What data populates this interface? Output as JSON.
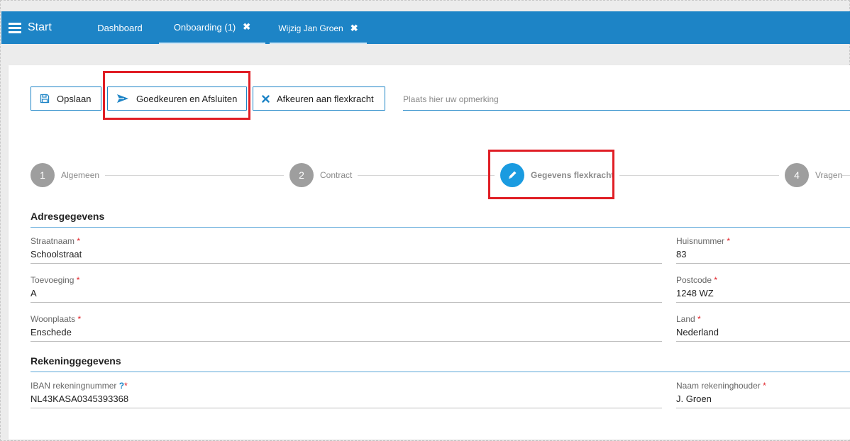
{
  "nav": {
    "start_label": "Start",
    "tabs": [
      {
        "label": "Dashboard"
      },
      {
        "label": "Onboarding (1)",
        "close": "✖"
      },
      {
        "label": "Wijzig Jan Groen",
        "close": "✖"
      }
    ]
  },
  "toolbar": {
    "save_label": "Opslaan",
    "approve_label": "Goedkeuren en Afsluiten",
    "reject_label": "Afkeuren aan flexkracht",
    "remark_placeholder": "Plaats hier uw opmerking"
  },
  "stepper": {
    "steps": [
      {
        "number": "1",
        "label": "Algemeen"
      },
      {
        "number": "2",
        "label": "Contract"
      },
      {
        "number": "",
        "label": "Gegevens flexkracht",
        "current": true,
        "icon": "pencil-icon"
      },
      {
        "number": "4",
        "label": "Vragen"
      }
    ]
  },
  "address": {
    "title": "Adresgegevens",
    "street": {
      "label": "Straatnaam",
      "value": "Schoolstraat"
    },
    "housenumber": {
      "label": "Huisnummer",
      "value": "83"
    },
    "addition": {
      "label": "Toevoeging",
      "value": "A"
    },
    "postcode": {
      "label": "Postcode",
      "value": "1248 WZ"
    },
    "city": {
      "label": "Woonplaats",
      "value": "Enschede"
    },
    "country": {
      "label": "Land",
      "value": "Nederland"
    }
  },
  "bank": {
    "title": "Rekeninggegevens",
    "iban": {
      "label": "IBAN rekeningnummer",
      "help": "?",
      "value": "NL43KASA0345393368"
    },
    "holder": {
      "label": "Naam rekeninghouder",
      "value": "J. Groen"
    }
  },
  "required_mark": "*",
  "colors": {
    "primary": "#1d84c6",
    "step_active": "#1a9be0",
    "step_inactive": "#9e9e9e",
    "highlight": "#e01e25",
    "required": "#e01e25"
  }
}
